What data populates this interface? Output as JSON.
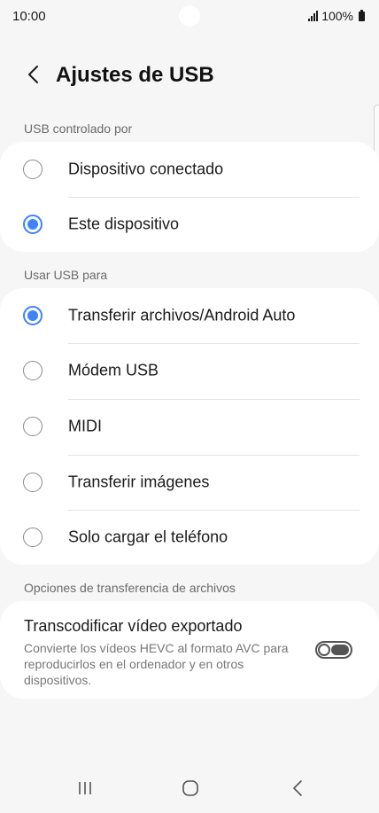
{
  "status_bar": {
    "time": "10:00",
    "battery": "100%"
  },
  "header": {
    "title": "Ajustes de USB"
  },
  "usb_controlled_by": {
    "label": "USB controlado por",
    "options": [
      {
        "label": "Dispositivo conectado",
        "checked": false
      },
      {
        "label": "Este dispositivo",
        "checked": true
      }
    ]
  },
  "use_usb_for": {
    "label": "Usar USB para",
    "options": [
      {
        "label": "Transferir archivos/Android Auto",
        "checked": true
      },
      {
        "label": "Módem USB",
        "checked": false
      },
      {
        "label": "MIDI",
        "checked": false
      },
      {
        "label": "Transferir imágenes",
        "checked": false
      },
      {
        "label": "Solo cargar el teléfono",
        "checked": false
      }
    ]
  },
  "file_transfer_options": {
    "label": "Opciones de transferencia de archivos",
    "transcode": {
      "title": "Transcodificar vídeo exportado",
      "description": "Convierte los vídeos HEVC al formato AVC para reproducirlos en el ordenador y en otros dispositivos.",
      "enabled": false
    }
  },
  "colors": {
    "accent": "#3e84f7",
    "background": "#f6f6f6",
    "card": "#ffffff"
  },
  "icons": {
    "back": "chevron-left-icon",
    "nav_recents": "recents-icon",
    "nav_home": "home-icon",
    "nav_back": "back-icon"
  }
}
